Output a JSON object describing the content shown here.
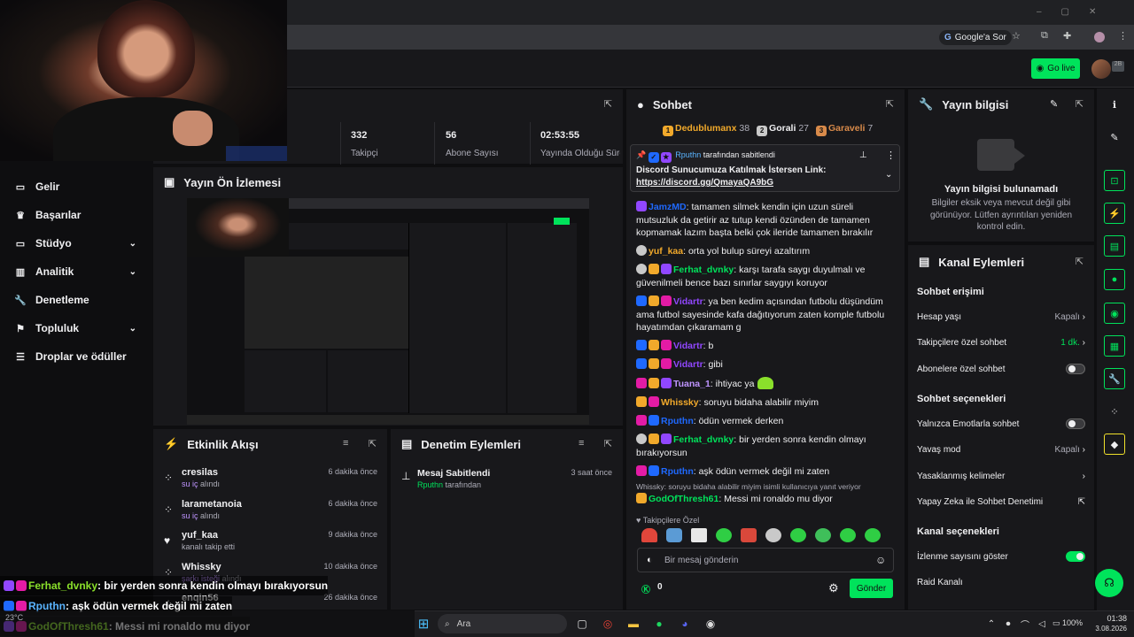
{
  "browser": {
    "google_btn": "Google'a Sor"
  },
  "topnav": {
    "go_live": "Go live",
    "avatar_badge": "2B"
  },
  "sidebar": {
    "items": [
      {
        "label": "Gelir",
        "icon": "revenue-icon",
        "chev": false
      },
      {
        "label": "Başarılar",
        "icon": "trophy-icon",
        "chev": false
      },
      {
        "label": "Stüdyo",
        "icon": "studio-icon",
        "chev": true
      },
      {
        "label": "Analitik",
        "icon": "analytics-icon",
        "chev": true
      },
      {
        "label": "Denetleme",
        "icon": "wrench-icon",
        "chev": false
      },
      {
        "label": "Topluluk",
        "icon": "community-icon",
        "chev": true
      },
      {
        "label": "Droplar ve ödüller",
        "icon": "gift-icon",
        "chev": false
      }
    ]
  },
  "stats": [
    {
      "value": "332",
      "label": "Takipçi"
    },
    {
      "value": "56",
      "label": "Abone Sayısı"
    },
    {
      "value": "02:53:55",
      "label": "Yayında Olduğu Süre"
    }
  ],
  "preview": {
    "title": "Yayın Ön İzlemesi"
  },
  "activity": {
    "title": "Etkinlik Akışı",
    "rows": [
      {
        "name": "cresilas",
        "sub_pre": "",
        "sub_hl": "su iç",
        "sub_post": " alındı",
        "time": "6 dakika önce",
        "icon": "points-icon"
      },
      {
        "name": "larametanoia",
        "sub_pre": "",
        "sub_hl": "su iç",
        "sub_post": " alındı",
        "time": "6 dakika önce",
        "icon": "points-icon"
      },
      {
        "name": "yuf_kaa",
        "sub_pre": "kanalı takip etti",
        "sub_hl": "",
        "sub_post": "",
        "time": "9 dakika önce",
        "icon": "heart-icon"
      },
      {
        "name": "Whissky",
        "sub_pre": "",
        "sub_hl": "şarkı isteği",
        "sub_post": " alındı",
        "time": "10 dakika önce",
        "icon": "points-icon"
      },
      {
        "name": "enqin56",
        "sub_pre": "",
        "sub_hl": "",
        "sub_post": "",
        "time": "26 dakika önce",
        "icon": "points-icon"
      }
    ]
  },
  "moderation": {
    "title": "Denetim Eylemleri",
    "item_title": "Mesaj Sabitlendi",
    "item_user": "Rputhn",
    "item_suffix": " tarafından",
    "item_time": "3 saat önce"
  },
  "chat": {
    "title": "Sohbet",
    "leaders": [
      {
        "rank": "1",
        "name": "Dedublumanx",
        "score": "38"
      },
      {
        "rank": "2",
        "name": "Gorali",
        "score": "27"
      },
      {
        "rank": "3",
        "name": "Garaveli",
        "score": "7"
      }
    ],
    "pinned_by_user": "Rputhn",
    "pinned_by_suffix": " tarafından sabitlendi",
    "pinned_text": "Discord Sunucumuza Katılmak İstersen Link:",
    "pinned_link": "https://discord.gg/QmayaQA9bG",
    "messages": [
      {
        "user": "JamzMD",
        "color": "#1f69ff",
        "text": "tamamen silmek kendin için uzun süreli mutsuzluk da getirir az tutup kendi özünden de tamamen kopmamak lazım başta belki çok ileride tamamen bırakılır"
      },
      {
        "user": "yuf_kaa",
        "color": "#f1a92b",
        "text": "orta yol bulup süreyi azaltırım"
      },
      {
        "user": "Ferhat_dvnky",
        "color": "#00e35b",
        "text": "karşı tarafa saygı duyulmalı ve güvenilmeli bence bazı sınırlar saygıyı koruyor"
      },
      {
        "user": "Vidartr",
        "color": "#9147ff",
        "text": "ya ben kedim açısından futbolu düşündüm ama futbol sayesinde kafa dağıtıyorum zaten komple futbolu hayatımdan çıkaramam g"
      },
      {
        "user": "Vidartr",
        "color": "#9147ff",
        "text": "b"
      },
      {
        "user": "Vidartr",
        "color": "#9147ff",
        "text": "gibi"
      },
      {
        "user": "Tuana_1",
        "color": "#bf94ff",
        "text": "ihtiyac ya"
      },
      {
        "user": "Whissky",
        "color": "#f1a92b",
        "text": "soruyu bidaha alabilir miyim"
      },
      {
        "user": "Rputhn",
        "color": "#1f69ff",
        "text": "ödün vermek derken"
      },
      {
        "user": "Ferhat_dvnky",
        "color": "#00e35b",
        "text": "bir yerden sonra kendin olmayı bırakıyorsun"
      },
      {
        "user": "Rputhn",
        "color": "#1f69ff",
        "text": "aşk ödün vermek değil mi zaten"
      },
      {
        "user": "GodOfThresh61",
        "color": "#00e35b",
        "text": "Messi mi ronaldo mu diyor"
      }
    ],
    "reply_note": "Whissky: soruyu bidaha alabilir miyim isimli kullanıcıya yanıt veriyor",
    "followers_label": "Takipçilere Özel",
    "input_placeholder": "Bir mesaj gönderin",
    "points": "0",
    "send_label": "Gönder"
  },
  "stream_info": {
    "title": "Yayın bilgisi",
    "empty_title": "Yayın bilgisi bulunamadı",
    "empty_body": "Bilgiler eksik veya mevcut değil gibi görünüyor. Lütfen ayrıntıları yeniden kontrol edin."
  },
  "channel_actions": {
    "title": "Kanal Eylemleri",
    "chat_access": "Sohbet erişimi",
    "account_age": "Hesap yaşı",
    "account_age_value": "Kapalı",
    "followers_only": "Takipçilere özel sohbet",
    "followers_only_value": "1 dk.",
    "subscribers_only": "Abonelere özel sohbet",
    "chat_options": "Sohbet seçenekleri",
    "emote_only": "Yalnızca Emotlarla sohbet",
    "slow_mode": "Yavaş mod",
    "slow_mode_value": "Kapalı",
    "banned_words": "Yasaklanmış kelimeler",
    "ai_moderation": "Yapay Zeka ile Sohbet Denetimi",
    "channel_options": "Kanal seçenekleri",
    "show_viewers": "İzlenme sayısını göster",
    "raid": "Raid Kanalı"
  },
  "overlay": [
    {
      "user": "Ferhat_dvnky",
      "color": "#8ae02b",
      "text": ": bir yerden sonra kendin olmayı bırakıyorsun"
    },
    {
      "user": "Rputhn",
      "color": "#5ab4ff",
      "text": ": aşk ödün vermek değil mi zaten"
    },
    {
      "user": "GodOfThresh61",
      "color": "#8ae02b",
      "text": ": Messi mi ronaldo mu diyor"
    }
  ],
  "taskbar": {
    "search": "Ara",
    "battery": "100%",
    "time": "01:38",
    "date": "3.08.2026",
    "weather": "23°C"
  }
}
